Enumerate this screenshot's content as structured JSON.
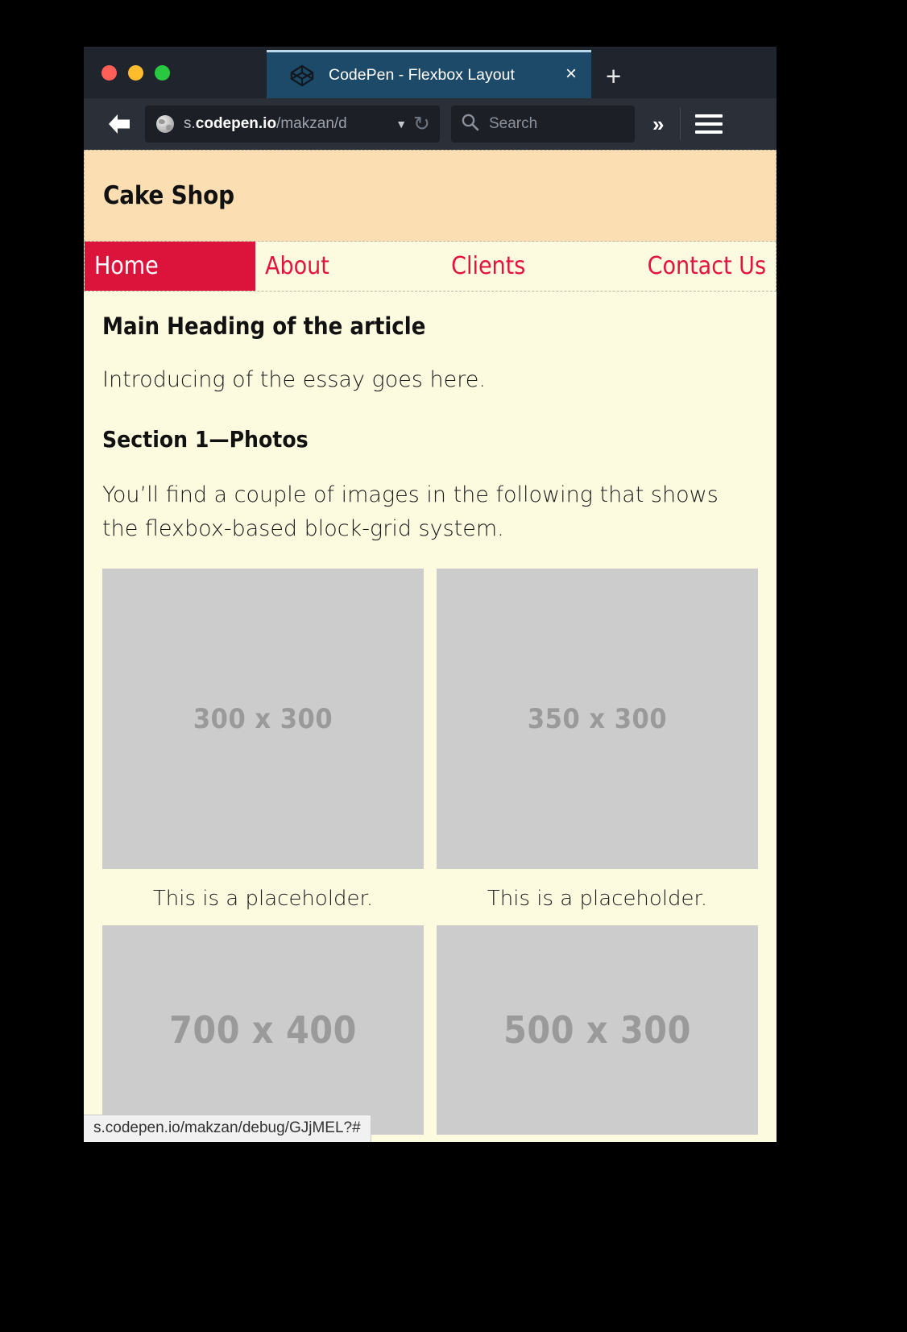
{
  "browser": {
    "traffic_lights": [
      "close",
      "minimize",
      "maximize"
    ],
    "tab": {
      "title": "CodePen - Flexbox Layout",
      "favicon": "codepen-logo-icon",
      "close_label": "×"
    },
    "new_tab_label": "+",
    "toolbar": {
      "back_icon": "back-arrow-icon",
      "url_host_prefix": "s.",
      "url_host": "codepen.io",
      "url_path": "/makzan/d",
      "url_dropdown_glyph": "▼",
      "reload_glyph": "↻",
      "search_placeholder": "Search",
      "overflow_glyph": "»",
      "menu_icon": "hamburger-menu-icon"
    },
    "status_bar": {
      "url": "s.codepen.io/makzan/debug/GJjMEL?#"
    }
  },
  "page": {
    "header": {
      "site_title": "Cake Shop"
    },
    "nav": {
      "items": [
        {
          "label": "Home",
          "active": true
        },
        {
          "label": "About",
          "active": false
        },
        {
          "label": "Clients",
          "active": false
        },
        {
          "label": "Contact Us",
          "active": false
        }
      ]
    },
    "article": {
      "main_heading": "Main Heading of the article",
      "intro_paragraph": "Introducing of the essay goes here.",
      "section_heading": "Section 1—Photos",
      "section_paragraph": "You’ll find a couple of images in the following that shows the flexbox-based block-grid system.",
      "photos": [
        {
          "label": "300 x 300",
          "caption": "This is a placeholder."
        },
        {
          "label": "350 x 300",
          "caption": "This is a placeholder."
        },
        {
          "label": "700 x 400",
          "caption": ""
        },
        {
          "label": "500 x 300",
          "caption": ""
        }
      ]
    },
    "colors": {
      "header_bg": "#fbdfb3",
      "page_bg": "#fdfbdf",
      "accent_red": "#dc143c",
      "link_red": "#e2143f",
      "placeholder_gray": "#cccccc",
      "placeholder_text": "#9a9a9a"
    }
  }
}
